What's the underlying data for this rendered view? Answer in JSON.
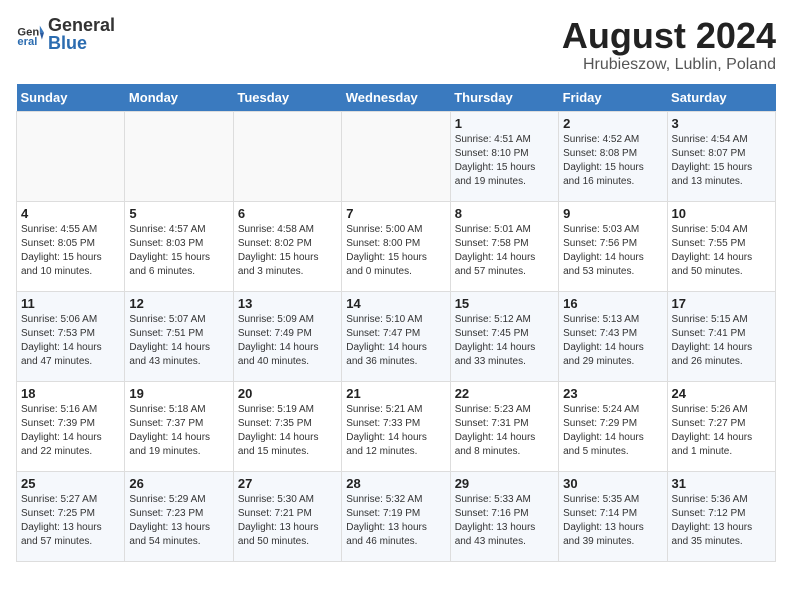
{
  "header": {
    "logo_general": "General",
    "logo_blue": "Blue",
    "title": "August 2024",
    "subtitle": "Hrubieszow, Lublin, Poland"
  },
  "weekdays": [
    "Sunday",
    "Monday",
    "Tuesday",
    "Wednesday",
    "Thursday",
    "Friday",
    "Saturday"
  ],
  "weeks": [
    [
      {
        "day": "",
        "info": ""
      },
      {
        "day": "",
        "info": ""
      },
      {
        "day": "",
        "info": ""
      },
      {
        "day": "",
        "info": ""
      },
      {
        "day": "1",
        "info": "Sunrise: 4:51 AM\nSunset: 8:10 PM\nDaylight: 15 hours\nand 19 minutes."
      },
      {
        "day": "2",
        "info": "Sunrise: 4:52 AM\nSunset: 8:08 PM\nDaylight: 15 hours\nand 16 minutes."
      },
      {
        "day": "3",
        "info": "Sunrise: 4:54 AM\nSunset: 8:07 PM\nDaylight: 15 hours\nand 13 minutes."
      }
    ],
    [
      {
        "day": "4",
        "info": "Sunrise: 4:55 AM\nSunset: 8:05 PM\nDaylight: 15 hours\nand 10 minutes."
      },
      {
        "day": "5",
        "info": "Sunrise: 4:57 AM\nSunset: 8:03 PM\nDaylight: 15 hours\nand 6 minutes."
      },
      {
        "day": "6",
        "info": "Sunrise: 4:58 AM\nSunset: 8:02 PM\nDaylight: 15 hours\nand 3 minutes."
      },
      {
        "day": "7",
        "info": "Sunrise: 5:00 AM\nSunset: 8:00 PM\nDaylight: 15 hours\nand 0 minutes."
      },
      {
        "day": "8",
        "info": "Sunrise: 5:01 AM\nSunset: 7:58 PM\nDaylight: 14 hours\nand 57 minutes."
      },
      {
        "day": "9",
        "info": "Sunrise: 5:03 AM\nSunset: 7:56 PM\nDaylight: 14 hours\nand 53 minutes."
      },
      {
        "day": "10",
        "info": "Sunrise: 5:04 AM\nSunset: 7:55 PM\nDaylight: 14 hours\nand 50 minutes."
      }
    ],
    [
      {
        "day": "11",
        "info": "Sunrise: 5:06 AM\nSunset: 7:53 PM\nDaylight: 14 hours\nand 47 minutes."
      },
      {
        "day": "12",
        "info": "Sunrise: 5:07 AM\nSunset: 7:51 PM\nDaylight: 14 hours\nand 43 minutes."
      },
      {
        "day": "13",
        "info": "Sunrise: 5:09 AM\nSunset: 7:49 PM\nDaylight: 14 hours\nand 40 minutes."
      },
      {
        "day": "14",
        "info": "Sunrise: 5:10 AM\nSunset: 7:47 PM\nDaylight: 14 hours\nand 36 minutes."
      },
      {
        "day": "15",
        "info": "Sunrise: 5:12 AM\nSunset: 7:45 PM\nDaylight: 14 hours\nand 33 minutes."
      },
      {
        "day": "16",
        "info": "Sunrise: 5:13 AM\nSunset: 7:43 PM\nDaylight: 14 hours\nand 29 minutes."
      },
      {
        "day": "17",
        "info": "Sunrise: 5:15 AM\nSunset: 7:41 PM\nDaylight: 14 hours\nand 26 minutes."
      }
    ],
    [
      {
        "day": "18",
        "info": "Sunrise: 5:16 AM\nSunset: 7:39 PM\nDaylight: 14 hours\nand 22 minutes."
      },
      {
        "day": "19",
        "info": "Sunrise: 5:18 AM\nSunset: 7:37 PM\nDaylight: 14 hours\nand 19 minutes."
      },
      {
        "day": "20",
        "info": "Sunrise: 5:19 AM\nSunset: 7:35 PM\nDaylight: 14 hours\nand 15 minutes."
      },
      {
        "day": "21",
        "info": "Sunrise: 5:21 AM\nSunset: 7:33 PM\nDaylight: 14 hours\nand 12 minutes."
      },
      {
        "day": "22",
        "info": "Sunrise: 5:23 AM\nSunset: 7:31 PM\nDaylight: 14 hours\nand 8 minutes."
      },
      {
        "day": "23",
        "info": "Sunrise: 5:24 AM\nSunset: 7:29 PM\nDaylight: 14 hours\nand 5 minutes."
      },
      {
        "day": "24",
        "info": "Sunrise: 5:26 AM\nSunset: 7:27 PM\nDaylight: 14 hours\nand 1 minute."
      }
    ],
    [
      {
        "day": "25",
        "info": "Sunrise: 5:27 AM\nSunset: 7:25 PM\nDaylight: 13 hours\nand 57 minutes."
      },
      {
        "day": "26",
        "info": "Sunrise: 5:29 AM\nSunset: 7:23 PM\nDaylight: 13 hours\nand 54 minutes."
      },
      {
        "day": "27",
        "info": "Sunrise: 5:30 AM\nSunset: 7:21 PM\nDaylight: 13 hours\nand 50 minutes."
      },
      {
        "day": "28",
        "info": "Sunrise: 5:32 AM\nSunset: 7:19 PM\nDaylight: 13 hours\nand 46 minutes."
      },
      {
        "day": "29",
        "info": "Sunrise: 5:33 AM\nSunset: 7:16 PM\nDaylight: 13 hours\nand 43 minutes."
      },
      {
        "day": "30",
        "info": "Sunrise: 5:35 AM\nSunset: 7:14 PM\nDaylight: 13 hours\nand 39 minutes."
      },
      {
        "day": "31",
        "info": "Sunrise: 5:36 AM\nSunset: 7:12 PM\nDaylight: 13 hours\nand 35 minutes."
      }
    ]
  ]
}
